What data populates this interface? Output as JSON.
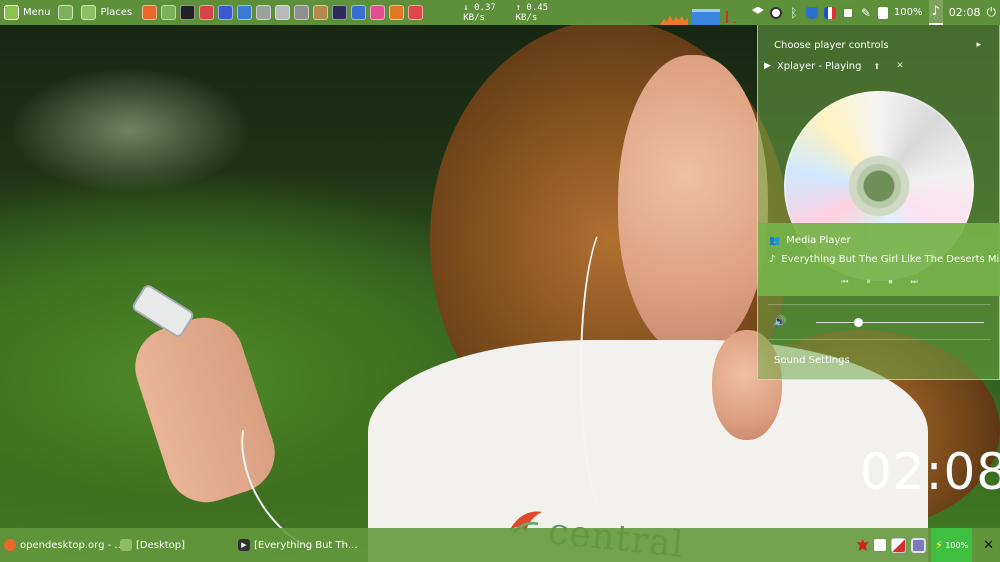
{
  "top_panel": {
    "menu_label": "Menu",
    "places_label": "Places",
    "launchers": [
      {
        "icon": "firefox-icon",
        "color": "#e8672b"
      },
      {
        "icon": "files-icon",
        "color": "#7cb05a"
      },
      {
        "icon": "terminal-icon",
        "color": "#222222"
      },
      {
        "icon": "presentation-icon",
        "color": "#d64545"
      },
      {
        "icon": "music-icon",
        "color": "#3a5bd0"
      },
      {
        "icon": "writer-icon",
        "color": "#3a7bd5"
      },
      {
        "icon": "image-viewer-icon",
        "color": "#9aa29a"
      },
      {
        "icon": "settings-icon",
        "color": "#b9b9b9"
      },
      {
        "icon": "privacy-icon",
        "color": "#8f8f8f"
      },
      {
        "icon": "archive-icon",
        "color": "#b48a50"
      },
      {
        "icon": "night-light-icon",
        "color": "#2d2d5a"
      },
      {
        "icon": "screenshot-icon",
        "color": "#3a6fd0"
      },
      {
        "icon": "color-picker-icon",
        "color": "#e05090"
      },
      {
        "icon": "paint-icon",
        "color": "#e07828"
      },
      {
        "icon": "help-icon",
        "color": "#e04848"
      }
    ],
    "net_down": "↓ 0.37 KB/s",
    "net_up": "↑ 0.45 KB/s",
    "battery_percent": "100%",
    "clock": "02:08",
    "tray_icons": [
      "dropbox-icon",
      "clock-icon",
      "bluetooth-icon",
      "shield-icon",
      "flag-fr-icon",
      "update-icon",
      "brightness-icon",
      "battery-icon"
    ]
  },
  "sound_menu": {
    "choose_player": "Choose player controls",
    "player_status": "Xplayer - Playing",
    "app_name": "Media Player",
    "track_title": "Everything But The Girl Like The Deserts Miss ...",
    "volume": 0.25,
    "sound_settings": "Sound Settings"
  },
  "desklet": {
    "time": "02:08"
  },
  "wallpaper": {
    "brand_text": "central"
  },
  "taskbar": {
    "tasks": [
      {
        "label": "opendesktop.org - ...",
        "icon": "firefox-icon"
      },
      {
        "label": "[Desktop]",
        "icon": "folder-icon"
      },
      {
        "label": "[Everything But Th...",
        "icon": "media-player-icon"
      }
    ],
    "battery_percent": "100%",
    "tray_icons": [
      "maple-leaf-icon",
      "camera-icon",
      "pdf-icon",
      "screenshot-tool-icon"
    ]
  },
  "colors": {
    "panel_green": "#64983e",
    "menu_highlight": "#76b248",
    "battery_green": "#3fbf3f"
  }
}
